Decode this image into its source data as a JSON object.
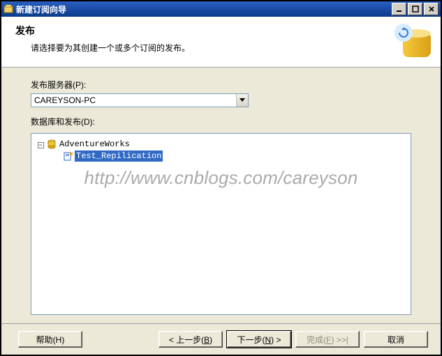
{
  "window": {
    "title": "新建订阅向导"
  },
  "header": {
    "title": "发布",
    "subtitle": "请选择要为其创建一个或多个订阅的发布。"
  },
  "form": {
    "publisher_label": "发布服务器(P):",
    "publisher_value": "CAREYSON-PC",
    "db_pub_label": "数据库和发布(D):"
  },
  "tree": {
    "root": {
      "label": "AdventureWorks",
      "expanded": true
    },
    "child": {
      "label": "Test_Repilication",
      "selected": true
    }
  },
  "watermark": "http://www.cnblogs.com/careyson",
  "buttons": {
    "help": "帮助(H)",
    "back_pre": "< 上一步(",
    "back_u": "B",
    "back_post": ")",
    "next_pre": "下一步(",
    "next_u": "N",
    "next_post": ") >",
    "finish_pre": "完成(",
    "finish_u": "F",
    "finish_post": ") >>|",
    "cancel": "取消"
  }
}
